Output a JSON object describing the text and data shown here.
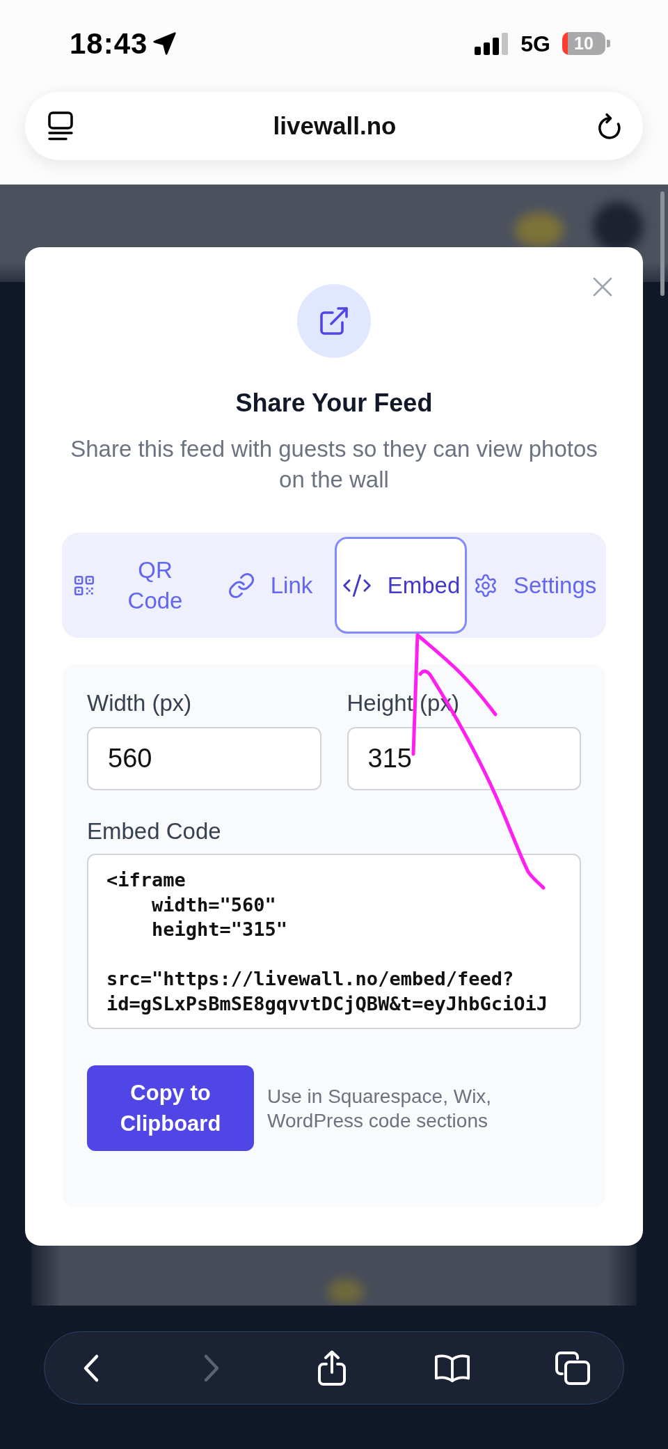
{
  "status_bar": {
    "time": "18:43",
    "network": "5G",
    "battery": "10"
  },
  "address_bar": {
    "url": "livewall.no"
  },
  "dialog": {
    "title": "Share Your Feed",
    "subtitle": "Share this feed with guests so they can view photos on the wall",
    "tabs": [
      {
        "kind": "qr",
        "label": "QR Code",
        "selected": false
      },
      {
        "kind": "link",
        "label": "Link",
        "selected": false
      },
      {
        "kind": "embed",
        "label": "Embed",
        "selected": true
      },
      {
        "kind": "settings",
        "label": "Settings",
        "selected": false
      }
    ],
    "fields": [
      {
        "label": "Width (px)",
        "value": "560"
      },
      {
        "label": "Height (px)",
        "value": "315"
      }
    ],
    "embed_code": {
      "label": "Embed Code",
      "value": "<iframe\n    width=\"560\"\n    height=\"315\"\n\nsrc=\"https://livewall.no/embed/feed?\nid=gSLxPsBmSE8gqvvtDCjQBW&t=eyJhbGciOiJ"
    },
    "copy_button": "Copy to Clipboard",
    "hint": "Use in Squarespace, Wix, WordPress code sections"
  },
  "toolbar": {
    "buttons": [
      {
        "kind": "back",
        "disabled": false
      },
      {
        "kind": "forward",
        "disabled": true
      },
      {
        "kind": "share",
        "disabled": false
      },
      {
        "kind": "bookmarks",
        "disabled": false
      },
      {
        "kind": "tabs",
        "disabled": false
      }
    ]
  }
}
